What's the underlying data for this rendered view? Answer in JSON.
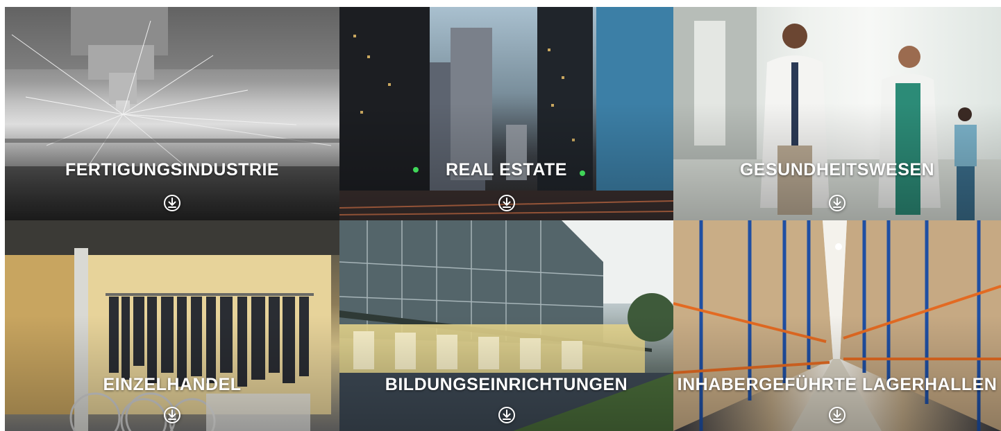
{
  "tiles": [
    {
      "title": "FERTIGUNGSINDUSTRIE",
      "icon": "download-icon"
    },
    {
      "title": "REAL ESTATE",
      "icon": "download-icon"
    },
    {
      "title": "GESUNDHEITSWESEN",
      "icon": "download-icon"
    },
    {
      "title": "EINZELHANDEL",
      "icon": "download-icon"
    },
    {
      "title": "BILDUNGSEINRICHTUNGEN",
      "icon": "download-icon"
    },
    {
      "title": "INHABERGEFÜHRTE LAGERHALLEN",
      "icon": "download-icon"
    }
  ],
  "colors": {
    "text": "#ffffff",
    "icon": "#ffffff"
  }
}
